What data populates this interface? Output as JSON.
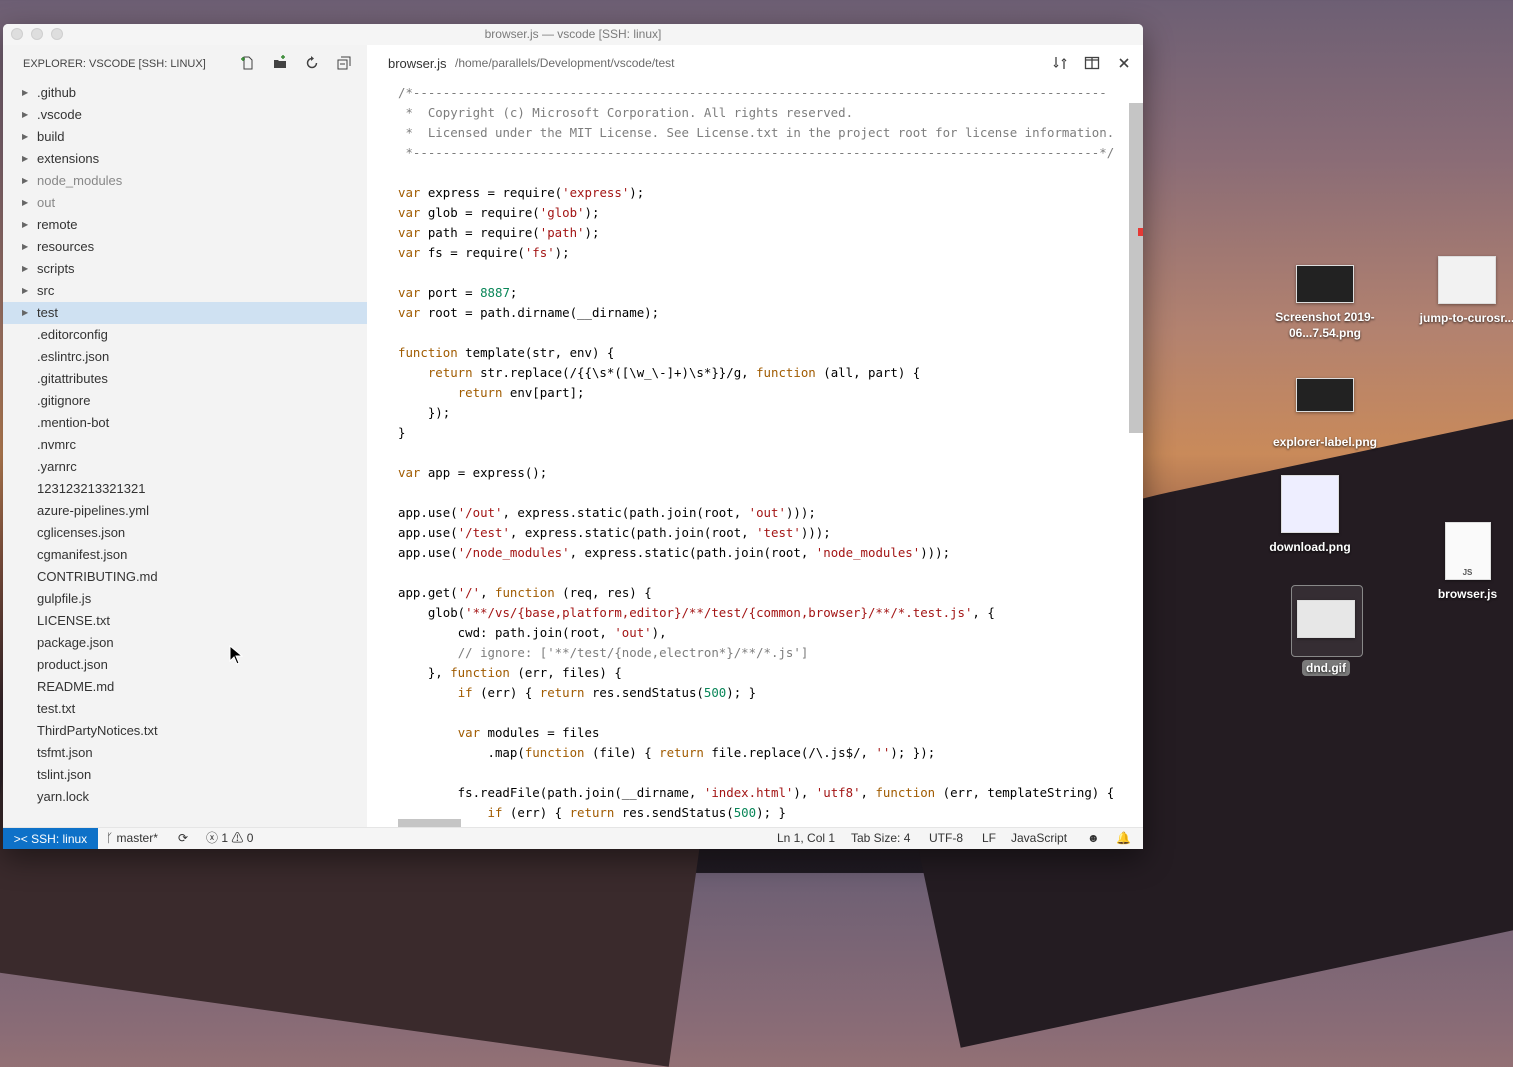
{
  "window": {
    "title": "browser.js — vscode [SSH: linux]"
  },
  "sidebar": {
    "header": "EXPLORER: VSCODE [SSH: LINUX]",
    "actions": [
      "new-file-icon",
      "new-folder-icon",
      "refresh-icon",
      "collapse-all-icon"
    ],
    "folders": [
      ".github",
      ".vscode",
      "build",
      "extensions",
      "node_modules",
      "out",
      "remote",
      "resources",
      "scripts",
      "src",
      "test"
    ],
    "files": [
      ".editorconfig",
      ".eslintrc.json",
      ".gitattributes",
      ".gitignore",
      ".mention-bot",
      ".nvmrc",
      ".yarnrc",
      "123123213321321",
      "azure-pipelines.yml",
      "cglicenses.json",
      "cgmanifest.json",
      "CONTRIBUTING.md",
      "gulpfile.js",
      "LICENSE.txt",
      "package.json",
      "product.json",
      "README.md",
      "test.txt",
      "ThirdPartyNotices.txt",
      "tsfmt.json",
      "tslint.json",
      "yarn.lock"
    ],
    "selected_folder": "test"
  },
  "editor": {
    "tab": {
      "file": "browser.js",
      "path": "/home/parallels/Development/vscode/test"
    },
    "code_lines": [
      "/*---------------------------------------------------------------------------------------------",
      " *  Copyright (c) Microsoft Corporation. All rights reserved.",
      " *  Licensed under the MIT License. See License.txt in the project root for license information.",
      " *--------------------------------------------------------------------------------------------*/",
      "",
      "var express = require('express');",
      "var glob = require('glob');",
      "var path = require('path');",
      "var fs = require('fs');",
      "",
      "var port = 8887;",
      "var root = path.dirname(__dirname);",
      "",
      "function template(str, env) {",
      "    return str.replace(/{{\\s*([\\w_\\-]+)\\s*}}/g, function (all, part) {",
      "        return env[part];",
      "    });",
      "}",
      "",
      "var app = express();",
      "",
      "app.use('/out', express.static(path.join(root, 'out')));",
      "app.use('/test', express.static(path.join(root, 'test')));",
      "app.use('/node_modules', express.static(path.join(root, 'node_modules')));",
      "",
      "app.get('/', function (req, res) {",
      "    glob('**/vs/{base,platform,editor}/**/test/{common,browser}/**/*.test.js', {",
      "        cwd: path.join(root, 'out'),",
      "        // ignore: ['**/test/{node,electron*}/**/*.js']",
      "    }, function (err, files) {",
      "        if (err) { return res.sendStatus(500); }",
      "",
      "        var modules = files",
      "            .map(function (file) { return file.replace(/\\.js$/, ''); });",
      "",
      "        fs.readFile(path.join(__dirname, 'index.html'), 'utf8', function (err, templateString) {",
      "            if (err) { return res.sendStatus(500); }"
    ]
  },
  "statusbar": {
    "remote": "SSH: linux",
    "branch": "master*",
    "errors": "1",
    "warnings": "0",
    "position": "Ln 1, Col 1",
    "tab_size": "Tab Size: 4",
    "encoding": "UTF-8",
    "eol": "LF",
    "language": "JavaScript"
  },
  "desktop": {
    "icons": [
      {
        "name": "Screenshot 2019-06...7.54.png"
      },
      {
        "name": "jump-to-curosr..."
      },
      {
        "name": "explorer-label.png"
      },
      {
        "name": "download.png"
      },
      {
        "name": "browser.js"
      },
      {
        "name": "dnd.gif"
      }
    ]
  },
  "colors": {
    "status_remote_bg": "#0e71c8",
    "selection_bg": "#cfe1f2",
    "sidebar_bg": "#f3f3f3"
  }
}
